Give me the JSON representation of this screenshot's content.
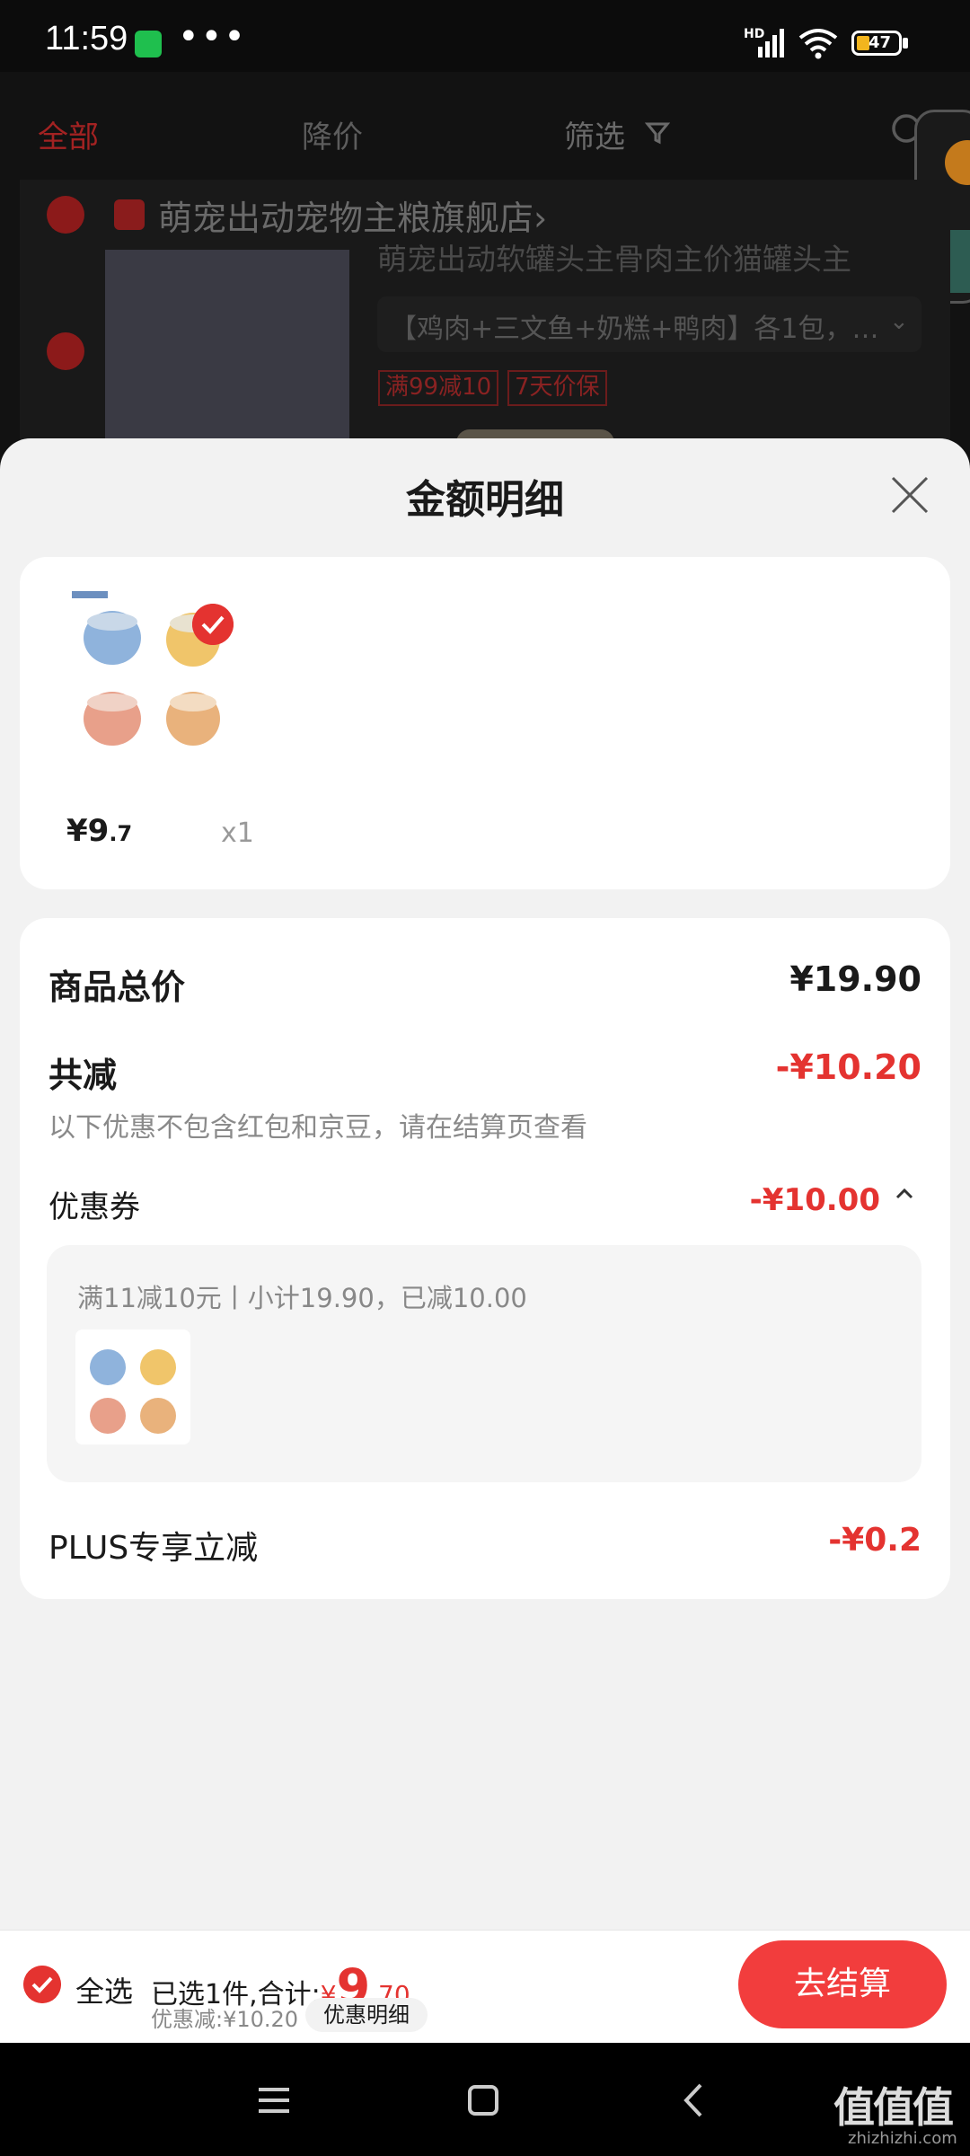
{
  "status_bar": {
    "time": "11:59",
    "network": "HD",
    "battery": "47",
    "more": "•••"
  },
  "cart_bg": {
    "tabs": [
      "全部",
      "降价",
      "筛选"
    ],
    "store_name": "萌宠出动宠物主粮旗舰店",
    "store_chevron": "›",
    "product_title": "萌宠出动软罐头主骨肉主价猫罐头主",
    "variant": "【鸡肉+三文鱼+奶糕+鸭肉】各1包，…",
    "variant_chevron": "⌄",
    "tags": [
      "满99减10",
      "7天价保"
    ]
  },
  "sheet": {
    "title": "金额明细",
    "product": {
      "price_int": "¥9",
      "price_dec": ".7",
      "qty": "x1"
    },
    "detail": {
      "total_label": "商品总价",
      "total_value": "¥19.90",
      "discount_label": "共减",
      "discount_value": "-¥10.20",
      "note": "以下优惠不包含红包和京豆，请在结算页查看",
      "coupon_label": "优惠券",
      "coupon_value": "-¥10.00",
      "coupon_rule": "满11减10元丨小计19.90，已减10.00",
      "plus_label": "PLUS专享立减",
      "plus_value": "-¥0.2"
    }
  },
  "bottom_bar": {
    "select_all": "全选",
    "summary_prefix": "已选1件,合计:",
    "currency": "¥",
    "total_int": "9",
    "total_dec": ".70",
    "saved": "优惠减:¥10.20",
    "detail_button": "优惠明细",
    "checkout": "去结算"
  },
  "watermark": {
    "text": "值值值",
    "url": "zhizhizhi.com"
  },
  "colors": {
    "accent": "#e43330",
    "checkout": "#f23d3d"
  }
}
